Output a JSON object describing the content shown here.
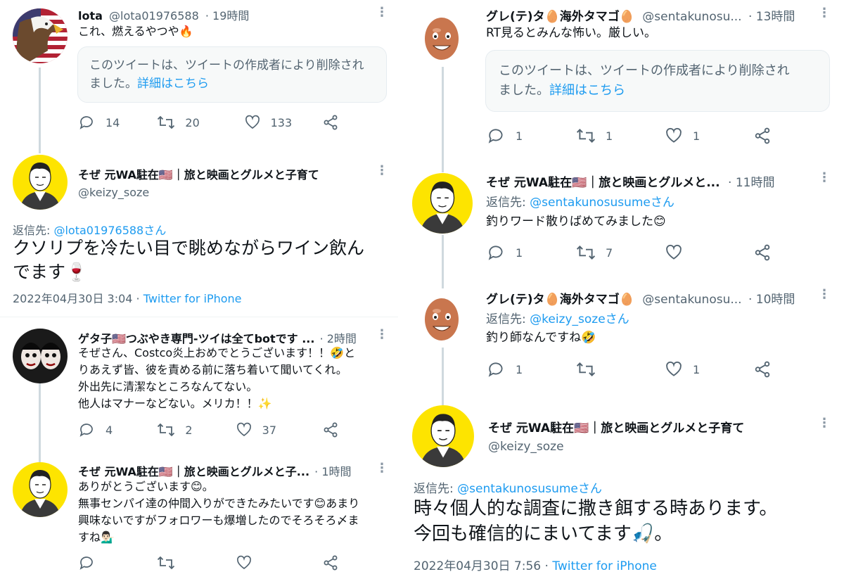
{
  "left": {
    "tweet1": {
      "name": "lota",
      "handle": "@lota01976588",
      "time": "· 19時間",
      "text": "これ、燃えるやつや🔥",
      "deleted_line1": "このツイートは、ツイートの作成者により削除され",
      "deleted_line2": "ました。",
      "deleted_link": "詳細はこちら",
      "replies": "14",
      "retweets": "20",
      "likes": "133"
    },
    "main": {
      "name": "そぜ 元WA駐在🇺🇸｜旅と映画とグルメと子育て",
      "handle": "@keizy_soze",
      "reply_label": "返信先: ",
      "reply_to": "@lota01976588さん",
      "text_line1": "クソリプを冷たい目で眺めながらワイン飲ん",
      "text_line2": "でます🍷",
      "timestamp": "2022年04月30日 3:04 · ",
      "source": "Twitter for iPhone"
    },
    "tweet3": {
      "name": "ゲタ子🇺🇸つぶやき専門-ツイは全てbotです ...",
      "time": "· 2時間",
      "line1": "そぜさん、Costco炎上おめでとうございます！！🤣と",
      "line2": "りあえず皆、彼を責める前に落ち着いて聞いてくれ。",
      "line3": "外出先に清潔なところなんてない。",
      "line4": "他人はマナーなどない。メリカ！！✨",
      "replies": "4",
      "retweets": "2",
      "likes": "37"
    },
    "tweet4": {
      "name": "そぜ 元WA駐在🇺🇸｜旅と映画とグルメと子...",
      "time": "· 1時間",
      "line1": "ありがとうございます😊。",
      "line2": "無事センパイ達の仲間入りができたみたいです😊あまり",
      "line3": "興味ないですがフォロワーも爆増したのでそろそろ〆ま",
      "line4": "すね💁🏻‍♂️"
    }
  },
  "right": {
    "tweet1": {
      "name": "グレ(テ)タ🥚海外タマゴ🥚",
      "handle": "@sentakunosu...",
      "time": "· 13時間",
      "text": "RT見るとみんな怖い。厳しい。",
      "deleted_line1": "このツイートは、ツイートの作成者により削除され",
      "deleted_line2": "ました。",
      "deleted_link": "詳細はこちら",
      "replies": "1",
      "retweets": "1",
      "likes": "1"
    },
    "tweet2": {
      "name": "そぜ 元WA駐在🇺🇸｜旅と映画とグルメと...",
      "time": "· 11時間",
      "reply_label": "返信先: ",
      "reply_to": "@sentakunosusumeさん",
      "text": "釣りワード散りばめてみました😊",
      "replies": "1",
      "retweets": "7"
    },
    "tweet3": {
      "name": "グレ(テ)タ🥚海外タマゴ🥚",
      "handle": "@sentakunosu...",
      "time": "· 10時間",
      "reply_label": "返信先: ",
      "reply_to": "@keizy_sozeさん",
      "text": "釣り師なんですね🤣",
      "replies": "1",
      "likes": "1"
    },
    "main": {
      "name": "そぜ 元WA駐在🇺🇸｜旅と映画とグルメと子育て",
      "handle": "@keizy_soze",
      "reply_label": "返信先: ",
      "reply_to": "@sentakunosusumeさん",
      "text_line1": "時々個人的な調査に撒き餌する時あります。",
      "text_line2": "今回も確信的にまいてます🎣。",
      "timestamp": "2022年04月30日 7:56 · ",
      "source": "Twitter for iPhone"
    }
  },
  "colors": {
    "accent": "#1d9bf0",
    "secondary": "#536471",
    "thread": "#cfd9de"
  }
}
